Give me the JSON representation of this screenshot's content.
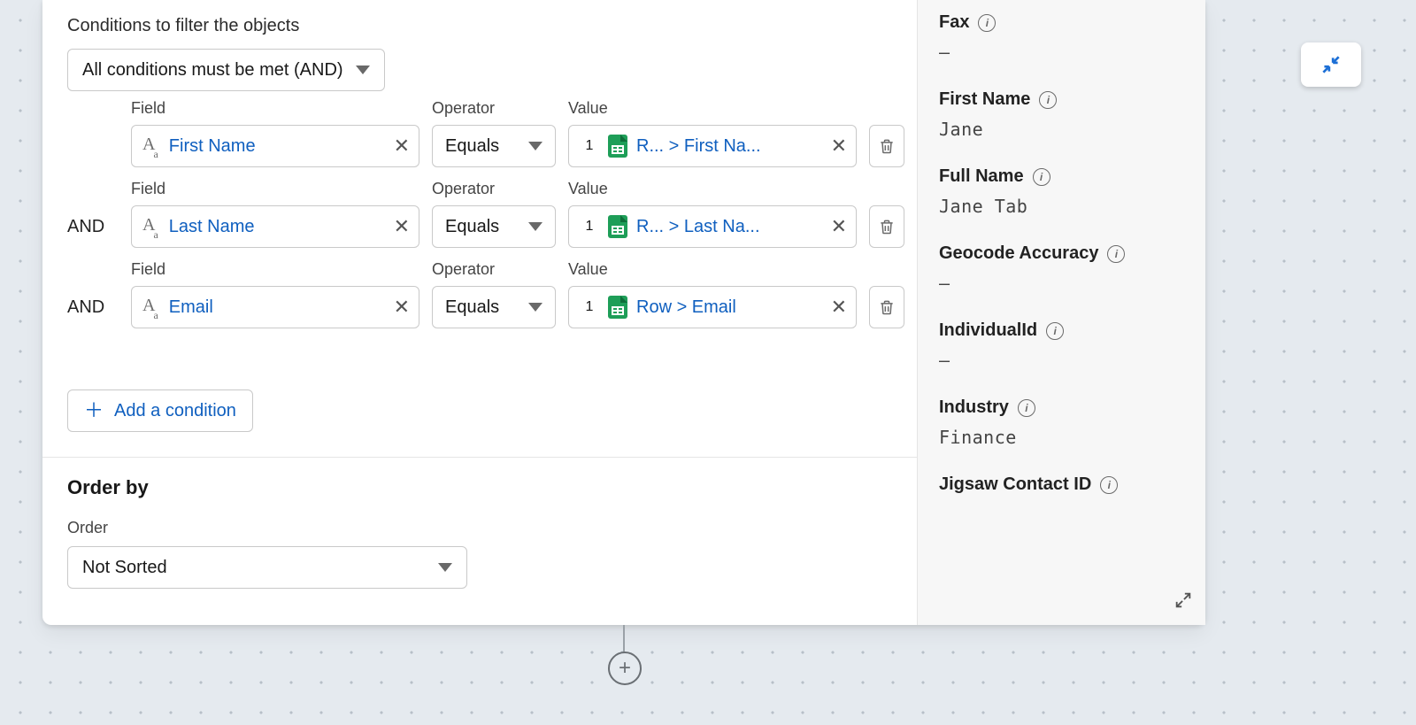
{
  "conditions": {
    "heading": "Conditions to filter the objects",
    "logic_selected": "All conditions must be met (AND)",
    "labels": {
      "field": "Field",
      "operator": "Operator",
      "value": "Value",
      "and": "AND"
    },
    "rows": [
      {
        "field": "First Name",
        "operator": "Equals",
        "value_index": "1",
        "value_path": "R...  > First Na..."
      },
      {
        "field": "Last Name",
        "operator": "Equals",
        "value_index": "1",
        "value_path": "R...  > Last Na..."
      },
      {
        "field": "Email",
        "operator": "Equals",
        "value_index": "1",
        "value_path": "Row > Email"
      }
    ],
    "add_label": "Add a condition"
  },
  "order": {
    "heading": "Order by",
    "label": "Order",
    "selected": "Not Sorted"
  },
  "side_panel": {
    "items": [
      {
        "label": "Fax",
        "value": "–"
      },
      {
        "label": "First Name",
        "value": "Jane"
      },
      {
        "label": "Full Name",
        "value": "Jane Tab"
      },
      {
        "label": "Geocode Accuracy",
        "value": "–"
      },
      {
        "label": "IndividualId",
        "value": "–"
      },
      {
        "label": "Industry",
        "value": "Finance"
      },
      {
        "label": "Jigsaw Contact ID",
        "value": ""
      }
    ]
  }
}
